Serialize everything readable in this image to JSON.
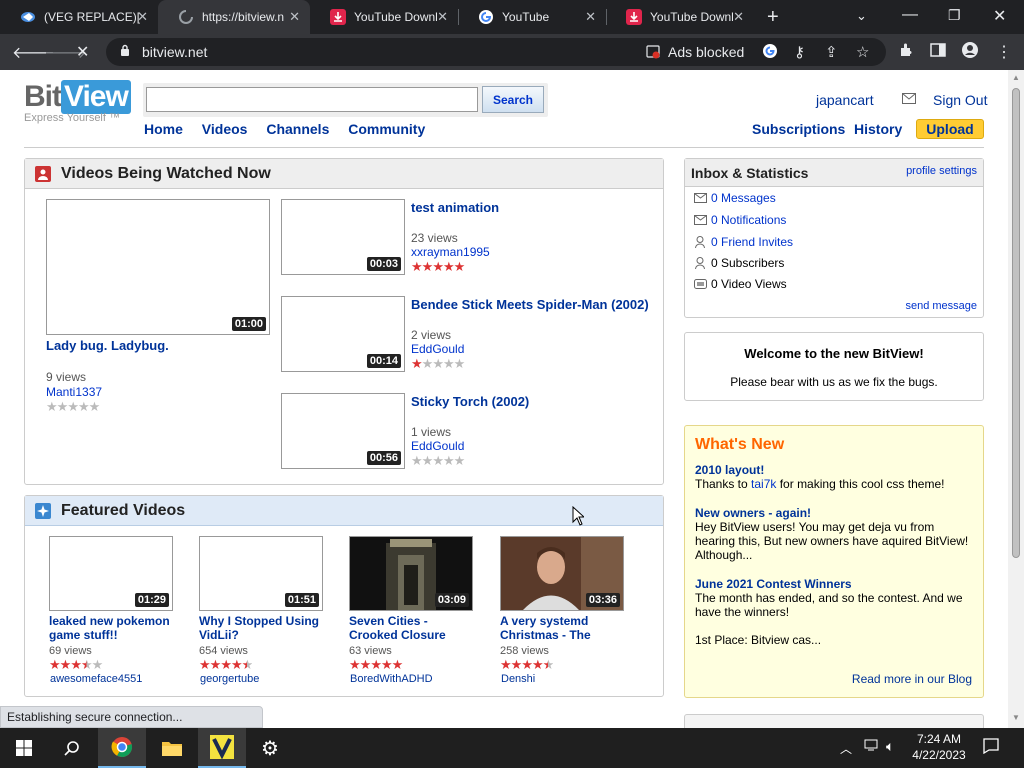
{
  "browser": {
    "tabs": [
      {
        "title": "(VEG REPLACE)[I",
        "icon": "vegas-icon"
      },
      {
        "title": "https://bitview.n",
        "icon": "loading-icon"
      },
      {
        "title": "YouTube Downl",
        "icon": "download-icon"
      },
      {
        "title": "YouTube",
        "icon": "google-icon"
      },
      {
        "title": "YouTube Downl",
        "icon": "download-icon"
      }
    ],
    "url": "bitview.net",
    "ads_blocked_label": "Ads blocked"
  },
  "site": {
    "logo_bit": "Bit",
    "logo_view": "View",
    "tagline": "Express Yourself ™",
    "search_button": "Search",
    "search_value": "",
    "nav": [
      "Home",
      "Videos",
      "Channels",
      "Community"
    ],
    "username": "japancart",
    "sign_out": "Sign Out",
    "subnav": [
      "Subscriptions",
      "History"
    ],
    "upload": "Upload"
  },
  "watched_now": {
    "heading": "Videos Being Watched Now",
    "main": {
      "title": "Lady bug. Ladybug.",
      "views": "9 views",
      "author": "Manti1337",
      "duration": "01:00",
      "rating": 0
    },
    "list": [
      {
        "title": "test animation",
        "views": "23 views",
        "author": "xxrayman1995",
        "duration": "00:03",
        "rating": 5
      },
      {
        "title": "Bendee Stick Meets Spider-Man (2002)",
        "views": "2 views",
        "author": "EddGould",
        "duration": "00:14",
        "rating": 1
      },
      {
        "title": "Sticky Torch (2002)",
        "views": "1 views",
        "author": "EddGould",
        "duration": "00:56",
        "rating": 0
      }
    ]
  },
  "featured": {
    "heading": "Featured Videos",
    "videos": [
      {
        "title": "leaked new pokemon game stuff!!",
        "views": "69 views",
        "author": "awesomeface4551",
        "duration": "01:29",
        "rating": 3.5
      },
      {
        "title": "Why I Stopped Using VidLii?",
        "views": "654 views",
        "author": "georgertube",
        "duration": "01:51",
        "rating": 4.5
      },
      {
        "title": "Seven Cities - Crooked Closure",
        "views": "63 views",
        "author": "BoredWithADHD",
        "duration": "03:09",
        "rating": 5
      },
      {
        "title": "A very systemd Christmas - The",
        "views": "258 views",
        "author": "Denshi",
        "duration": "03:36",
        "rating": 4.5
      }
    ]
  },
  "inbox": {
    "heading": "Inbox & Statistics",
    "profile_settings": "profile settings",
    "rows": [
      {
        "text": "0 Messages",
        "link": true,
        "icon": "envelope-icon"
      },
      {
        "text": "0 Notifications",
        "link": true,
        "icon": "envelope-icon"
      },
      {
        "text": "0 Friend Invites",
        "link": true,
        "icon": "person-icon"
      },
      {
        "text": "0 Subscribers",
        "link": false,
        "icon": "person-icon"
      },
      {
        "text": "0 Video Views",
        "link": false,
        "icon": "tv-icon"
      }
    ],
    "send_message": "send message"
  },
  "welcome": {
    "title": "Welcome to the new BitView!",
    "text": "Please bear with us as we fix the bugs."
  },
  "whats_new": {
    "heading": "What's New",
    "items": [
      {
        "title": "2010 layout!",
        "text_before": "Thanks to ",
        "link": "tai7k",
        "text_after": " for making this cool css theme!"
      },
      {
        "title": "New owners - again!",
        "text": "Hey BitView users! You may get deja vu from hearing this, But new owners have aquired BitView! Although..."
      },
      {
        "title": "June 2021 Contest Winners",
        "text": "The month has ended, and so the contest. And we have the winners!",
        "extra": "1st Place: Bitview cas..."
      }
    ],
    "read_more": "Read more in our Blog"
  },
  "status_text": "Establishing secure connection...",
  "clock": {
    "time": "7:24 AM",
    "date": "4/22/2023"
  }
}
